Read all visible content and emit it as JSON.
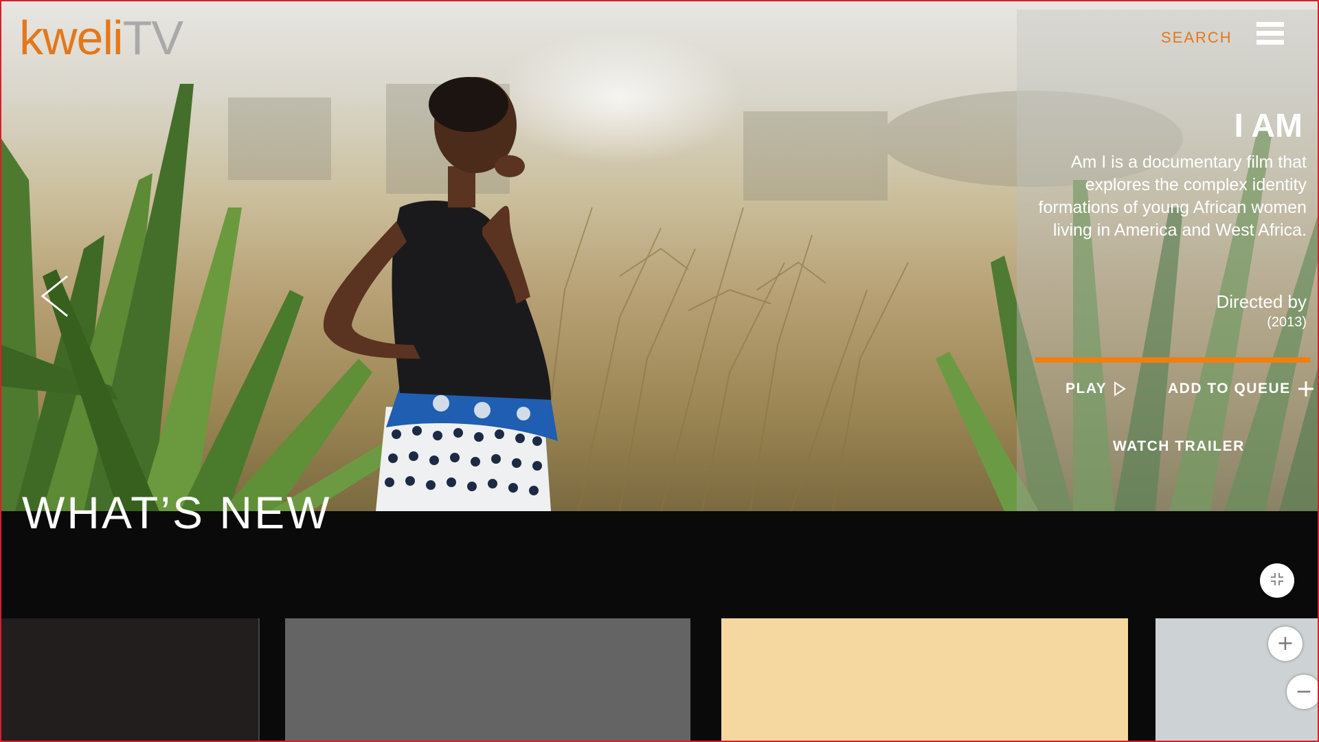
{
  "app": {
    "logo_primary": "kweli",
    "logo_secondary": "TV"
  },
  "header": {
    "search_label": "SEARCH",
    "menu_icon": "hamburger-menu-icon"
  },
  "hero": {
    "prev_icon": "chevron-left-icon",
    "title": "I AM",
    "description": "Am I is a documentary film that explores the complex identity formations of young African women living in America and West Africa.",
    "directed_by": "Directed by",
    "year": "(2013)",
    "progress_fraction": 1.0,
    "progress_color": "#f07f10",
    "actions": {
      "play_label": "PLAY",
      "play_icon": "play-triangle-icon",
      "queue_label": "ADD TO QUEUE",
      "queue_icon": "plus-icon",
      "trailer_label": "WATCH TRAILER"
    }
  },
  "section": {
    "title": "WHAT’S NEW",
    "collapse_icon": "collapse-arrows-icon",
    "zoom_in_icon": "zoom-in-plus-icon",
    "zoom_out_icon": "zoom-out-minus-icon",
    "thumbnail_colors": [
      "#221e1e",
      "#646464",
      "#f5d8a0",
      "#cdd3d4"
    ]
  },
  "colors": {
    "accent": "#e3781b",
    "frame_border": "#d6202a",
    "background": "#0a0a0a"
  }
}
